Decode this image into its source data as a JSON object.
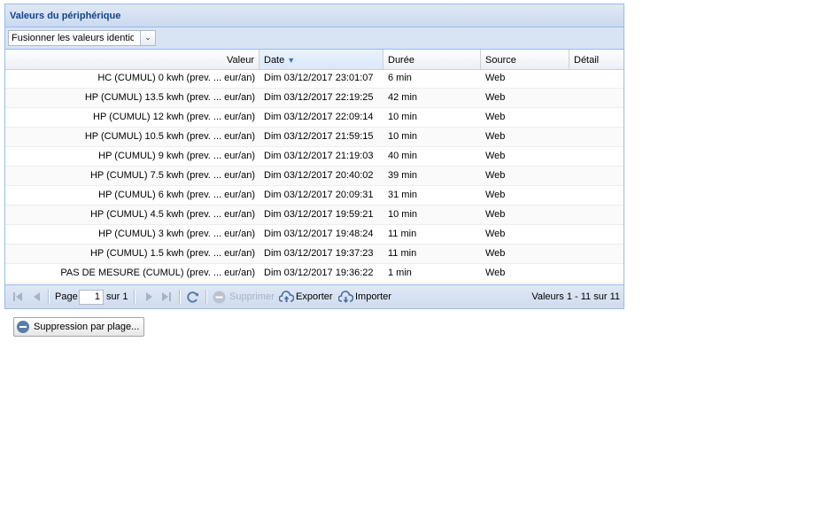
{
  "panel": {
    "title": "Valeurs du périphérique"
  },
  "toolbar": {
    "combo_value": "Fusionner les valeurs identiques"
  },
  "columns": {
    "valeur": "Valeur",
    "date": "Date",
    "duree": "Durée",
    "source": "Source",
    "detail": "Détail"
  },
  "rows": [
    {
      "valeur": "HC (CUMUL) 0 kwh (prev. ... eur/an)",
      "date": "Dim 03/12/2017 23:01:07",
      "duree": "6 min",
      "source": "Web",
      "detail": ""
    },
    {
      "valeur": "HP (CUMUL) 13.5 kwh (prev. ... eur/an)",
      "date": "Dim 03/12/2017 22:19:25",
      "duree": "42 min",
      "source": "Web",
      "detail": ""
    },
    {
      "valeur": "HP (CUMUL) 12 kwh (prev. ... eur/an)",
      "date": "Dim 03/12/2017 22:09:14",
      "duree": "10 min",
      "source": "Web",
      "detail": ""
    },
    {
      "valeur": "HP (CUMUL) 10.5 kwh (prev. ... eur/an)",
      "date": "Dim 03/12/2017 21:59:15",
      "duree": "10 min",
      "source": "Web",
      "detail": ""
    },
    {
      "valeur": "HP (CUMUL) 9 kwh (prev. ... eur/an)",
      "date": "Dim 03/12/2017 21:19:03",
      "duree": "40 min",
      "source": "Web",
      "detail": ""
    },
    {
      "valeur": "HP (CUMUL) 7.5 kwh (prev. ... eur/an)",
      "date": "Dim 03/12/2017 20:40:02",
      "duree": "39 min",
      "source": "Web",
      "detail": ""
    },
    {
      "valeur": "HP (CUMUL) 6 kwh (prev. ... eur/an)",
      "date": "Dim 03/12/2017 20:09:31",
      "duree": "31 min",
      "source": "Web",
      "detail": ""
    },
    {
      "valeur": "HP (CUMUL) 4.5 kwh (prev. ... eur/an)",
      "date": "Dim 03/12/2017 19:59:21",
      "duree": "10 min",
      "source": "Web",
      "detail": ""
    },
    {
      "valeur": "HP (CUMUL) 3 kwh (prev. ... eur/an)",
      "date": "Dim 03/12/2017 19:48:24",
      "duree": "11 min",
      "source": "Web",
      "detail": ""
    },
    {
      "valeur": "HP (CUMUL) 1.5 kwh (prev. ... eur/an)",
      "date": "Dim 03/12/2017 19:37:23",
      "duree": "11 min",
      "source": "Web",
      "detail": ""
    },
    {
      "valeur": "PAS DE MESURE (CUMUL) (prev. ... eur/an)",
      "date": "Dim 03/12/2017 19:36:22",
      "duree": "1 min",
      "source": "Web",
      "detail": ""
    }
  ],
  "paging": {
    "page_label": "Page",
    "page_value": "1",
    "of_label": "sur 1",
    "delete_label": "Supprimer",
    "export_label": "Exporter",
    "import_label": "Importer",
    "display_msg": "Valeurs 1 - 11 sur 11"
  },
  "range_button": {
    "label": "Suppression par plage..."
  },
  "colors": {
    "header_text": "#15428b",
    "border": "#99bbe8",
    "toolbar_bg": "#d8e4f3"
  }
}
